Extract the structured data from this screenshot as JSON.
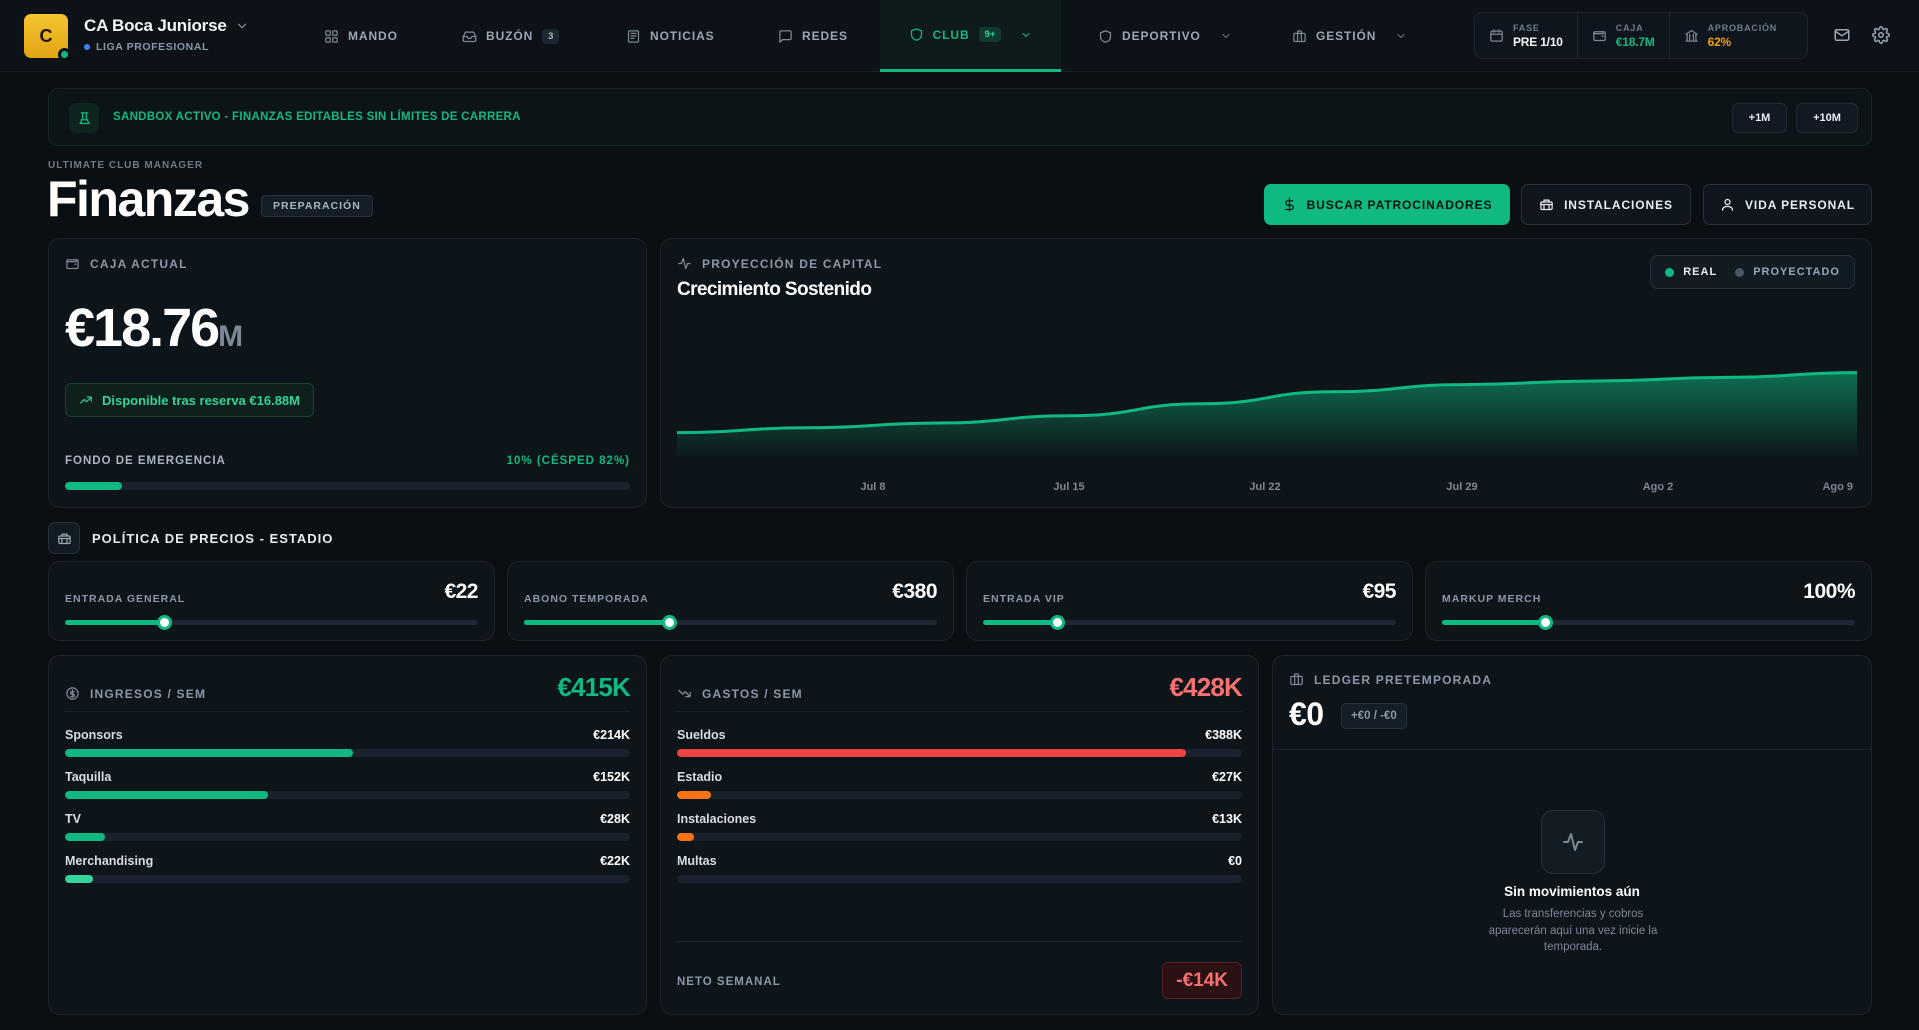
{
  "club": {
    "name": "CA Boca Juniorse",
    "initial": "C",
    "league": "LIGA PROFESIONAL"
  },
  "nav": {
    "mando": "MANDO",
    "buzon": "BUZÓN",
    "buzon_count": "3",
    "noticias": "NOTICIAS",
    "redes": "REDES",
    "club": "CLUB",
    "club_badge": "9+",
    "deportivo": "DEPORTIVO",
    "gestion": "GESTIÓN"
  },
  "stats": {
    "fase_label": "FASE",
    "fase_value": "PRE 1/10",
    "caja_label": "CAJA",
    "caja_value": "€18.7M",
    "aprobacion_label": "APROBACIÓN",
    "aprobacion_value": "62%"
  },
  "banner": {
    "text": "SANDBOX ACTIVO - FINANZAS EDITABLES SIN LÍMITES DE CARRERA",
    "btn_1m": "+1M",
    "btn_10m": "+10M"
  },
  "header": {
    "eyebrow": "ULTIMATE CLUB MANAGER",
    "title": "Finanzas",
    "phase": "PREPARACIÓN",
    "btn_sponsors": "BUSCAR PATROCINADORES",
    "btn_facilities": "INSTALACIONES",
    "btn_personal": "VIDA PERSONAL"
  },
  "cash": {
    "label": "CAJA ACTUAL",
    "amount": "€18.76",
    "unit": "M",
    "available": "Disponible tras reserva €16.88M",
    "fund_label": "FONDO DE EMERGENCIA",
    "fund_value": "10% (CÉSPED 82%)",
    "fund_fraction": 0.1
  },
  "projection": {
    "label": "PROYECCIÓN DE CAPITAL",
    "title": "Crecimiento Sostenido",
    "legend_real": "REAL",
    "legend_projected": "PROYECTADO"
  },
  "chart_data": {
    "type": "area",
    "title": "Crecimiento Sostenido",
    "x_ticks": [
      "Jul 8",
      "Jul 15",
      "Jul 22",
      "Jul 29",
      "Ago 2",
      "Ago 9"
    ],
    "series": [
      {
        "name": "REAL",
        "values": [
          0.22,
          0.26,
          0.3,
          0.36,
          0.46,
          0.56,
          0.62,
          0.65,
          0.68,
          0.72
        ]
      }
    ],
    "legend": [
      "REAL",
      "PROYECTADO"
    ],
    "grid": false,
    "colors": {
      "real": "#10b981",
      "projected": "#4b5663"
    }
  },
  "pricing": {
    "section_title": "POLÍTICA DE PRECIOS - ESTADIO",
    "items": [
      {
        "label": "ENTRADA GENERAL",
        "value": "€22",
        "level": 0.24
      },
      {
        "label": "ABONO TEMPORADA",
        "value": "€380",
        "level": 0.35
      },
      {
        "label": "ENTRADA VIP",
        "value": "€95",
        "level": 0.18
      },
      {
        "label": "MARKUP MERCH",
        "value": "100%",
        "level": 0.25
      }
    ]
  },
  "income": {
    "label": "INGRESOS / SEM",
    "total": "€415K",
    "rows": [
      {
        "name": "Sponsors",
        "value": "€214K",
        "fraction": 0.51,
        "color": "#10b981"
      },
      {
        "name": "Taquilla",
        "value": "€152K",
        "fraction": 0.36,
        "color": "#10b981"
      },
      {
        "name": "TV",
        "value": "€28K",
        "fraction": 0.07,
        "color": "#10b981"
      },
      {
        "name": "Merchandising",
        "value": "€22K",
        "fraction": 0.05,
        "color": "#34d399"
      }
    ]
  },
  "expenses": {
    "label": "GASTOS / SEM",
    "total": "€428K",
    "rows": [
      {
        "name": "Sueldos",
        "value": "€388K",
        "fraction": 0.9,
        "color": "#ef4444"
      },
      {
        "name": "Estadio",
        "value": "€27K",
        "fraction": 0.06,
        "color": "#f97316"
      },
      {
        "name": "Instalaciones",
        "value": "€13K",
        "fraction": 0.03,
        "color": "#f97316"
      },
      {
        "name": "Multas",
        "value": "€0",
        "fraction": 0.0,
        "color": "#f97316"
      }
    ],
    "net_label": "NETO SEMANAL",
    "net_value": "-€14K"
  },
  "ledger": {
    "label": "LEDGER PRETEMPORADA",
    "amount": "€0",
    "sub": "+€0 / -€0",
    "empty_title": "Sin movimientos aún",
    "empty_text": "Las transferencias y cobros aparecerán aquí una vez inicie la temporada."
  },
  "colors": {
    "accent": "#10b981",
    "income_total": "#10b981",
    "expense_total": "#f87171",
    "approval": "#f59e0b",
    "cash": "#10b981"
  }
}
